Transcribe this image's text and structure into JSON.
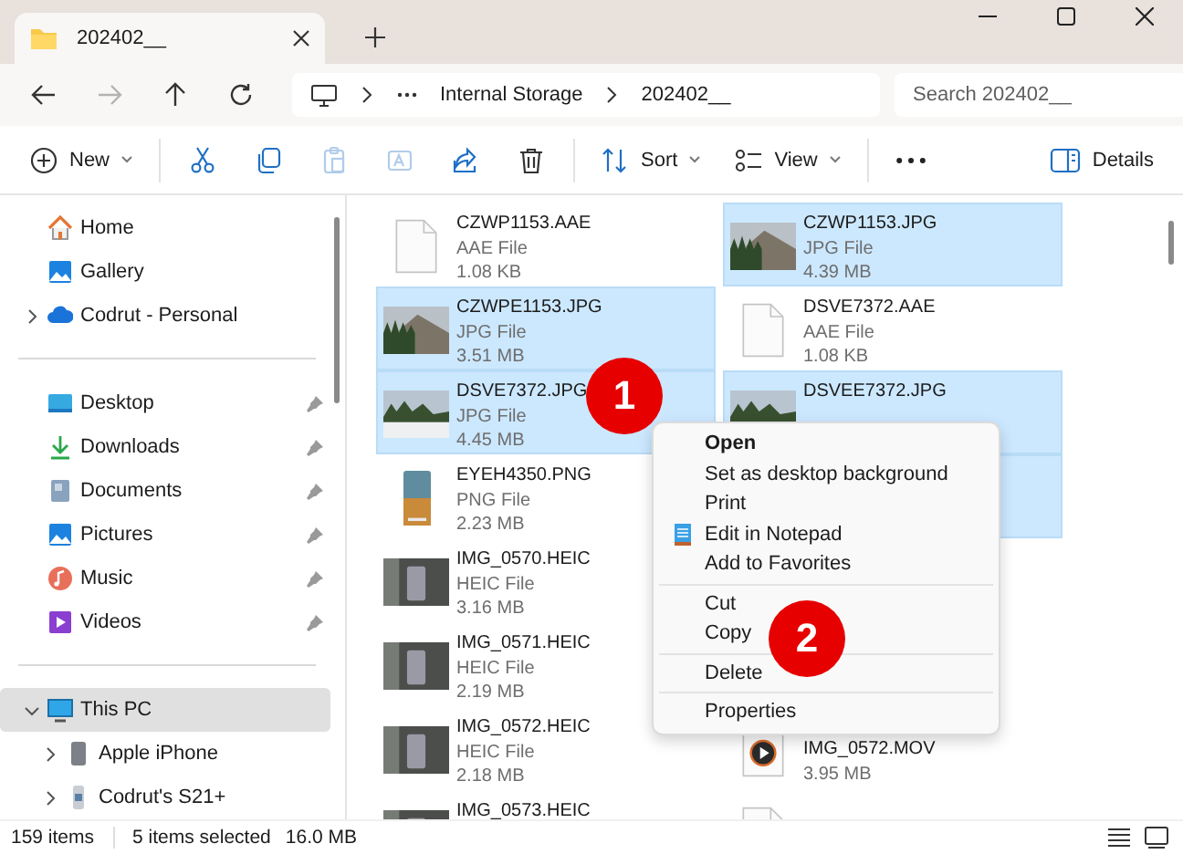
{
  "window": {
    "tab": {
      "title": "202402__"
    }
  },
  "navigation": {
    "buttons": [
      {
        "kind": "back",
        "disabled": false
      },
      {
        "kind": "forward",
        "disabled": true
      },
      {
        "kind": "up",
        "disabled": false
      },
      {
        "kind": "refresh",
        "disabled": false
      }
    ],
    "breadcrumb": [
      "Internal Storage",
      "202402__"
    ],
    "search": {
      "placeholder": "Search 202402__"
    }
  },
  "toolbar": {
    "items": [
      {
        "kind": "new",
        "label": "New",
        "disabled": false
      },
      {
        "kind": "separator"
      },
      {
        "kind": "cut",
        "disabled": false
      },
      {
        "kind": "copy",
        "disabled": false
      },
      {
        "kind": "paste",
        "disabled": true
      },
      {
        "kind": "rename",
        "disabled": true
      },
      {
        "kind": "share",
        "disabled": false
      },
      {
        "kind": "delete",
        "disabled": false
      },
      {
        "kind": "separator"
      },
      {
        "kind": "sort",
        "label": "Sort",
        "disabled": false
      },
      {
        "kind": "view",
        "label": "View",
        "disabled": false
      },
      {
        "kind": "separator"
      },
      {
        "kind": "more",
        "disabled": false
      }
    ],
    "details": {
      "label": "Details"
    }
  },
  "sidebar": {
    "groups": [
      {
        "items": [
          {
            "kind": "home",
            "label": "Home",
            "selected": false,
            "pinned": false
          },
          {
            "kind": "gallery",
            "label": "Gallery",
            "selected": false,
            "pinned": false
          },
          {
            "kind": "cloud",
            "label": "Codrut - Personal",
            "selected": false,
            "pinned": false,
            "expanded": false
          }
        ]
      },
      {
        "items": [
          {
            "kind": "desktop",
            "label": "Desktop",
            "selected": false,
            "pinned": true
          },
          {
            "kind": "downloads",
            "label": "Downloads",
            "selected": false,
            "pinned": true
          },
          {
            "kind": "documents",
            "label": "Documents",
            "selected": false,
            "pinned": true
          },
          {
            "kind": "pictures",
            "label": "Pictures",
            "selected": false,
            "pinned": true
          },
          {
            "kind": "music",
            "label": "Music",
            "selected": false,
            "pinned": true
          },
          {
            "kind": "videos",
            "label": "Videos",
            "selected": false,
            "pinned": true
          }
        ]
      },
      {
        "items": [
          {
            "kind": "pc",
            "label": "This PC",
            "selected": true,
            "pinned": false,
            "expanded": true,
            "children": [
              {
                "kind": "iphone",
                "label": "Apple iPhone",
                "selected": false,
                "pinned": false,
                "expanded": false
              },
              {
                "kind": "android",
                "label": "Codrut's S21+",
                "selected": false,
                "pinned": false,
                "expanded": false
              }
            ]
          }
        ]
      }
    ]
  },
  "files": [
    {
      "kind": "document",
      "name": "CZWP1153.AAE",
      "type": "AAE File",
      "size": "1.08 KB",
      "selected": false
    },
    {
      "kind": "photo",
      "name": "CZWP1153.JPG",
      "type": "JPG File",
      "size": "4.39 MB",
      "selected": true
    },
    {
      "kind": "photo",
      "name": "CZWPE1153.JPG",
      "type": "JPG File",
      "size": "3.51 MB",
      "selected": true
    },
    {
      "kind": "document",
      "name": "DSVE7372.AAE",
      "type": "AAE File",
      "size": "1.08 KB",
      "selected": false
    },
    {
      "kind": "snow",
      "name": "DSVE7372.JPG",
      "type": "JPG File",
      "size": "4.45 MB",
      "selected": true
    },
    {
      "kind": "snow",
      "name": "DSVEE7372.JPG",
      "selected": true
    },
    {
      "kind": "screenshot",
      "name": "EYEH4350.PNG",
      "type": "PNG File",
      "size": "2.23 MB",
      "selected": false
    },
    {
      "kind": "hidden",
      "selected": true
    },
    {
      "kind": "heic",
      "name": "IMG_0570.HEIC",
      "type": "HEIC File",
      "size": "3.16 MB",
      "selected": false
    },
    {
      "kind": "blank"
    },
    {
      "kind": "heic",
      "name": "IMG_0571.HEIC",
      "type": "HEIC File",
      "size": "2.19 MB",
      "selected": false
    },
    {
      "kind": "blank"
    },
    {
      "kind": "heic",
      "name": "IMG_0572.HEIC",
      "type": "HEIC File",
      "size": "2.18 MB",
      "selected": false
    },
    {
      "kind": "video",
      "name": "IMG_0572.MOV",
      "size": "3.95 MB",
      "selected": false
    },
    {
      "kind": "heic",
      "name": "IMG_0573.HEIC",
      "selected": false
    },
    {
      "kind": "document",
      "selected": false
    }
  ],
  "context_menu": {
    "items": [
      {
        "kind": "item",
        "label": "Open",
        "default": true
      },
      {
        "kind": "item",
        "label": "Set as desktop background",
        "default": false
      },
      {
        "kind": "item",
        "label": "Print",
        "default": false
      },
      {
        "kind": "app",
        "label": "Edit in Notepad",
        "default": false
      },
      {
        "kind": "item",
        "label": "Add to Favorites",
        "default": false
      },
      {
        "kind": "separator"
      },
      {
        "kind": "item",
        "label": "Cut",
        "default": false
      },
      {
        "kind": "item",
        "label": "Copy",
        "default": false
      },
      {
        "kind": "separator"
      },
      {
        "kind": "item",
        "label": "Delete",
        "default": false
      },
      {
        "kind": "separator"
      },
      {
        "kind": "item",
        "label": "Properties",
        "default": false
      }
    ]
  },
  "callouts": [
    {
      "label": "1"
    },
    {
      "label": "2"
    }
  ],
  "status_bar": {
    "count": "159 items",
    "selection": "5 items selected",
    "size": "16.0 MB"
  }
}
